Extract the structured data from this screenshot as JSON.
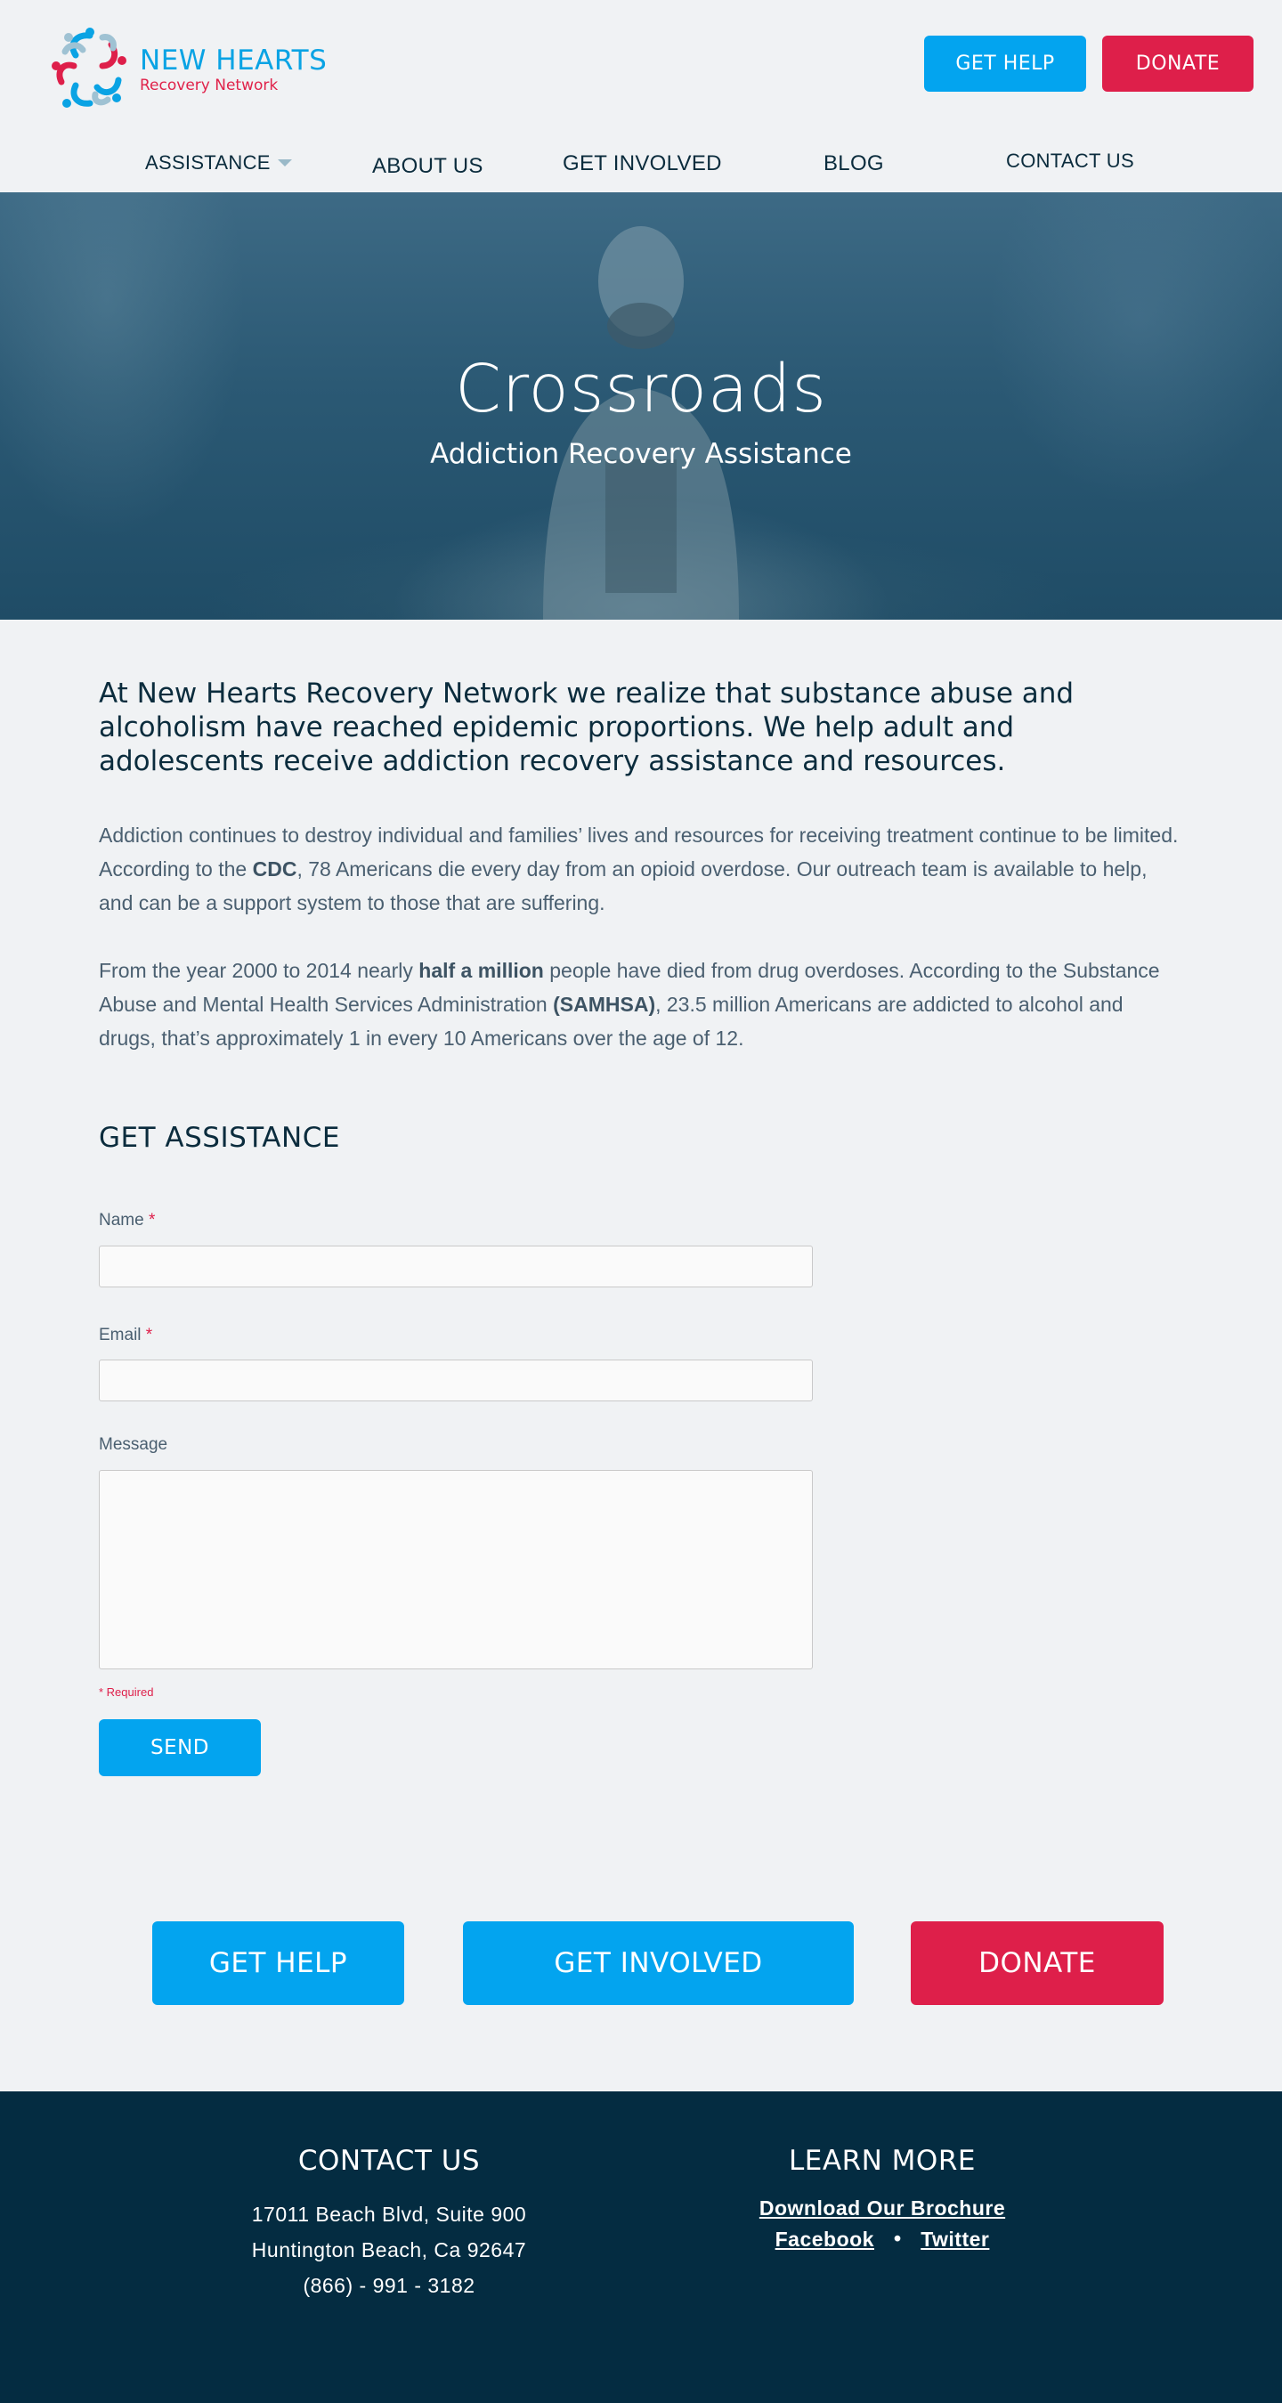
{
  "brand": {
    "name": "NEW HEARTS",
    "tagline": "Recovery Network",
    "colors": {
      "blue": "#03a4ef",
      "red": "#de1f4a",
      "navy": "#042c41"
    }
  },
  "header": {
    "get_help": "GET HELP",
    "donate": "DONATE"
  },
  "nav": {
    "assistance": "ASSISTANCE",
    "about": "ABOUT US",
    "involved": "GET INVOLVED",
    "blog": "BLOG",
    "contact": "CONTACT US"
  },
  "hero": {
    "title": "Crossroads",
    "subtitle": "Addiction Recovery Assistance"
  },
  "content": {
    "lead": "At New Hearts Recovery Network we realize that substance abuse and alcoholism have reached epidemic proportions. We help adult and adolescents receive addiction recovery assistance and resources.",
    "p1_a": "Addiction continues to destroy individual and families’ lives and resources for receiving treatment continue to be limited. According to the ",
    "p1_b": "CDC",
    "p1_c": ", 78 Americans die every day from an opioid overdose. Our outreach team is available to help, and can be a support system to those that are suffering.",
    "p2_a": "From the year 2000 to 2014 nearly ",
    "p2_b": "half a million",
    "p2_c": " people have died from drug overdoses.  According to the Substance Abuse and Mental Health Services Administration ",
    "p2_d": "(SAMHSA)",
    "p2_e": ", 23.5 million Americans are addicted to alcohol and drugs, that’s approximately 1 in every 10 Americans over the age of 12."
  },
  "form": {
    "title": "GET ASSISTANCE",
    "name_label": "Name",
    "email_label": "Email",
    "message_label": "Message",
    "required_marker": "*",
    "required_note": "* Required",
    "send": "SEND"
  },
  "cta": {
    "help": "GET HELP",
    "involved": "GET INVOLVED",
    "donate": "DONATE"
  },
  "footer": {
    "contact_title": "CONTACT US",
    "address1": "17011 Beach Blvd, Suite 900",
    "address2": "Huntington Beach, Ca 92647",
    "phone": "(866) - 991 - 3182",
    "learn_title": "LEARN MORE",
    "brochure": "Download Our Brochure",
    "facebook": "Facebook",
    "separator": "•",
    "twitter": "Twitter"
  }
}
